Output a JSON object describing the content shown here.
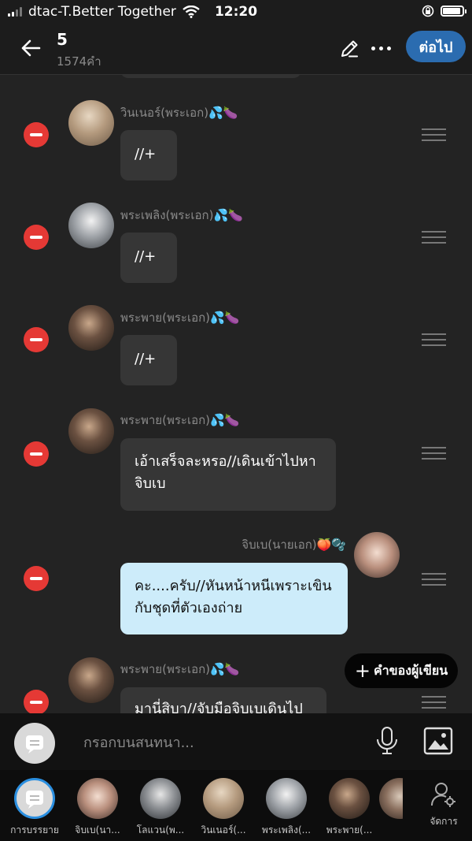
{
  "status_bar": {
    "carrier": "dtac-T.Better Together",
    "time": "12:20",
    "battery_level": 0.9
  },
  "header": {
    "title": "5",
    "subtitle": "1574คำ",
    "next_label": "ต่อไป"
  },
  "messages": [
    {
      "sender": "วินเนอร์(พระเอก)💦🍆",
      "text": "//+"
    },
    {
      "sender": "พระเพลิง(พระเอก)💦🍆",
      "text": "//+"
    },
    {
      "sender": "พระพาย(พระเอก)💦🍆",
      "text": "//+"
    },
    {
      "sender": "พระพาย(พระเอก)💦🍆",
      "text": "เอ้าเสร็จละหรอ//เดินเข้าไปหา\nจิบเบ"
    },
    {
      "sender": "จิบเบ(นายเอก)🍑🫧",
      "text": "คะ....ครับ//หันหน้าหนีเพราะเขิน\nกับชุดที่ตัวเองถ่าย"
    },
    {
      "sender": "พระพาย(พระเอก)💦🍆",
      "text": "มานี่สิบา//จับมือจิบเบเดินไป"
    }
  ],
  "author_note_label": "คำของผู้เขียน",
  "input": {
    "placeholder": "กรอกบนสนทนา..."
  },
  "characters": [
    {
      "name": "การบรรยาย"
    },
    {
      "name": "จิบเบ(นา..."
    },
    {
      "name": "โลแวน(พ..."
    },
    {
      "name": "วินเนอร์(..."
    },
    {
      "name": "พระเพลิง(..."
    },
    {
      "name": "พระพาย(..."
    }
  ],
  "manage_label": "จัดการ",
  "colors": {
    "accent": "#2b6cb0",
    "remove": "#e53935",
    "bubble_light": "#cdecfa"
  }
}
